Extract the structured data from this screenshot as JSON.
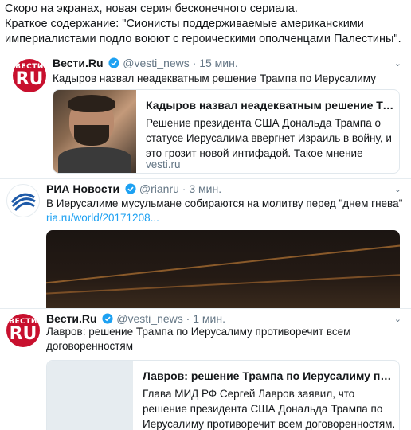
{
  "intro": {
    "line1": "Скоро на экранах, новая серия бесконечного сериала.",
    "line2": "Краткое содержание: \"Сионисты поддерживаемые американскими империалистами подло воюют с героическими ополченцами Палестины\"."
  },
  "tweets": [
    {
      "author": "Вести.Ru",
      "handle": "@vesti_news",
      "dot": "·",
      "time": "15 мин.",
      "text": "Кадыров назвал неадекватным решение Трампа по Иерусалиму",
      "avatar": {
        "top": "ВЕСТИ",
        "bottom": "RU"
      },
      "card": {
        "title": "Кадыров назвал неадекватным решение Трампа...",
        "description": "Решение президента США Дональда Трампа о статусе Иерусалима ввергнет Израиль в войну, и это грозит новой интифадой. Такое мнение высказал",
        "domain": "vesti.ru"
      }
    },
    {
      "author": "РИА Новости",
      "handle": "@rianru",
      "dot": "·",
      "time": "3 мин.",
      "text": "В Иерусалиме мусульмане собираются на молитву перед \"днем гнева\"",
      "link": "ria.ru/world/20171208..."
    },
    {
      "author": "Вести.Ru",
      "handle": "@vesti_news",
      "dot": "·",
      "time": "1 мин.",
      "text": "Лавров: решение Трампа по Иерусалиму противоречит всем договоренностям",
      "avatar": {
        "top": "ВЕСТИ",
        "bottom": "RU"
      },
      "card": {
        "title": "Лавров: решение Трампа по Иерусалиму против...",
        "description": "Глава МИД РФ Сергей Лавров заявил, что решение президента США Дональда Трампа по Иерусалиму противоречит всем договоренностям. По его мне..."
      }
    }
  ],
  "icons": {
    "verified": "verified-badge-icon",
    "menu": "chevron-down-icon"
  },
  "colors": {
    "accent": "#1da1f2",
    "vesti_red": "#c8102e",
    "muted": "#657786"
  }
}
